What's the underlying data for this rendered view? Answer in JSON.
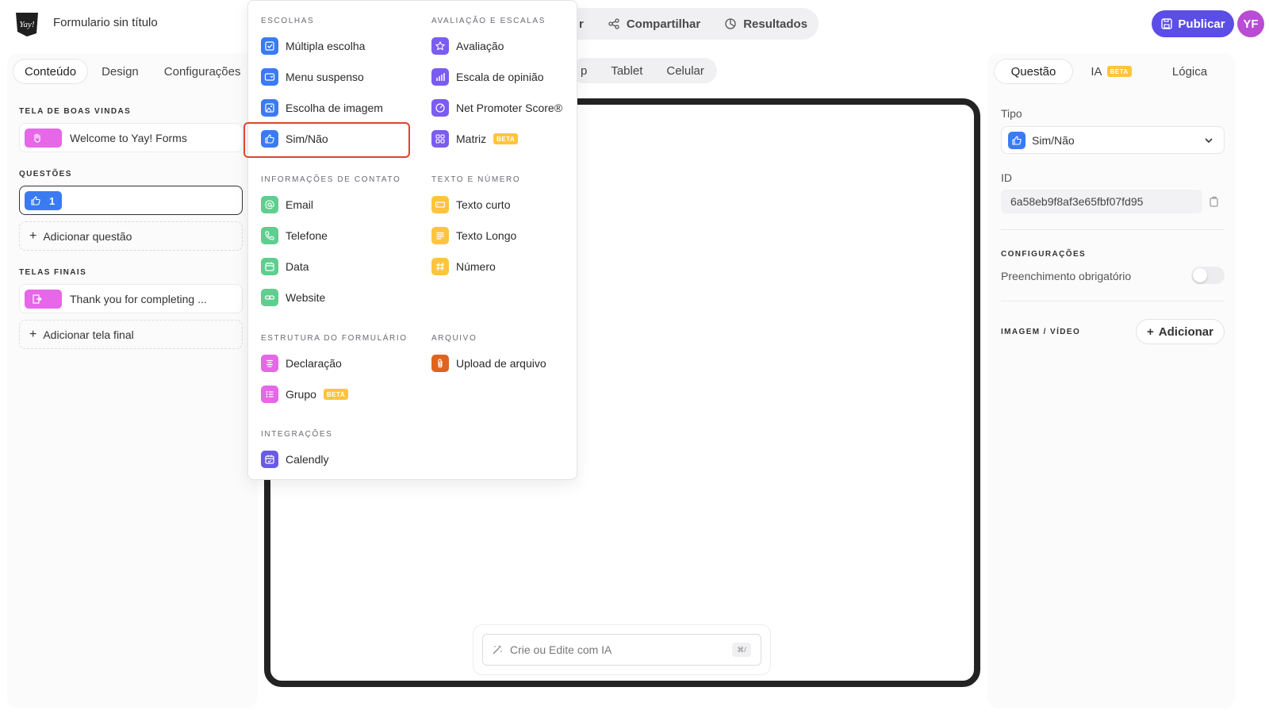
{
  "header": {
    "form_title": "Formulario sin título",
    "tabs": [
      {
        "label": "r",
        "icon": "partial"
      },
      {
        "label": "Compartilhar",
        "icon": "share-icon"
      },
      {
        "label": "Resultados",
        "icon": "chart-icon"
      }
    ],
    "publish_label": "Publicar",
    "avatar_initials": "YF"
  },
  "left": {
    "tabs": [
      "Conteúdo",
      "Design",
      "Configurações"
    ],
    "active_tab": "Conteúdo",
    "welcome_title": "TELA DE BOAS VINDAS",
    "welcome_item": "Welcome to Yay! Forms",
    "questions_title": "QUESTÕES",
    "question_number": "1",
    "add_question": "Adicionar questão",
    "final_title": "TELAS FINAIS",
    "final_item": "Thank you for completing ...",
    "add_final": "Adicionar tela final",
    "plus": "+"
  },
  "center": {
    "device_tabs": [
      "p",
      "Tablet",
      "Celular"
    ],
    "ai_placeholder": "Crie ou Edite com IA",
    "ai_shortcut": "⌘/"
  },
  "right": {
    "tabs": [
      "Questão",
      "IA",
      "Lógica"
    ],
    "beta": "BETA",
    "type_label": "Tipo",
    "type_value": "Sim/Não",
    "id_label": "ID",
    "id_value": "6a58eb9f8af3e65fbf07fd95",
    "config_title": "CONFIGURAÇÕES",
    "required_label": "Preenchimento obrigatório",
    "required_on": false,
    "media_title": "IMAGEM / VÍDEO",
    "add_label": "Adicionar"
  },
  "menu": {
    "sections": {
      "escolhas": "ESCOLHAS",
      "avaliacao": "AVALIAÇÃO E ESCALAS",
      "contato": "INFORMAÇÕES DE CONTATO",
      "texto": "TEXTO E NÚMERO",
      "estrutura": "ESTRUTURA DO FORMULÁRIO",
      "arquivo": "ARQUIVO",
      "integracoes": "INTEGRAÇÕES"
    },
    "items": {
      "multipla": "Múltipla escolha",
      "menu_suspenso": "Menu suspenso",
      "escolha_imagem": "Escolha de imagem",
      "sim_nao": "Sim/Não",
      "avaliacao": "Avaliação",
      "escala": "Escala de opinião",
      "nps": "Net Promoter Score®",
      "matriz": "Matriz",
      "email": "Email",
      "telefone": "Telefone",
      "data": "Data",
      "website": "Website",
      "texto_curto": "Texto curto",
      "texto_longo": "Texto Longo",
      "numero": "Número",
      "declaracao": "Declaração",
      "grupo": "Grupo",
      "upload": "Upload de arquivo",
      "calendly": "Calendly"
    },
    "beta": "BETA",
    "selected": "Sim/Não"
  },
  "colors": {
    "accent": "#5b4ee6",
    "blue": "#3a7bf2",
    "purple": "#7b5cf0",
    "green": "#5fce8f",
    "yellow": "#ffc43d",
    "pink": "#e667e8",
    "orange": "#e0641e",
    "highlight": "#e0432f"
  }
}
